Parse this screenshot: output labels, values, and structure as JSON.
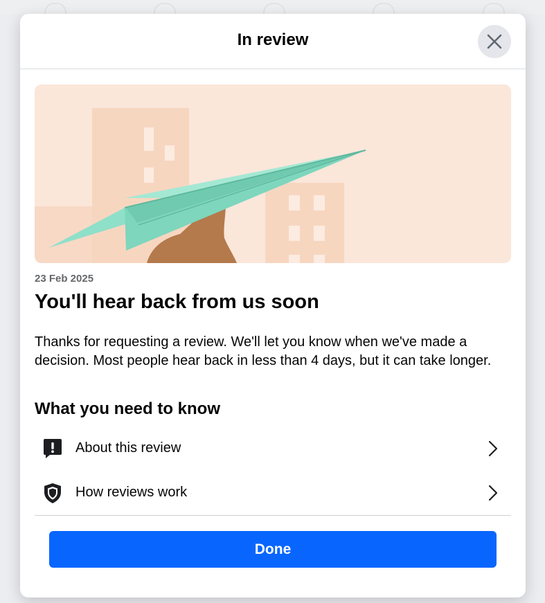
{
  "dialog": {
    "title": "In review",
    "date": "23 Feb 2025",
    "headline": "You'll hear back from us soon",
    "body": "Thanks for requesting a review. We'll let you know when we've made a decision. Most people hear back in less than 4 days, but it can take longer.",
    "section_title": "What you need to know",
    "items": [
      {
        "label": "About this review",
        "icon": "alert-icon"
      },
      {
        "label": "How reviews work",
        "icon": "shield-icon"
      }
    ],
    "done_label": "Done"
  },
  "colors": {
    "primary": "#0866ff",
    "text": "#050505",
    "secondary_text": "#65676b",
    "close_bg": "#e4e6eb",
    "hero_bg": "#fbe6da",
    "plane": "#8fe0c9",
    "hand": "#b47a4b"
  }
}
